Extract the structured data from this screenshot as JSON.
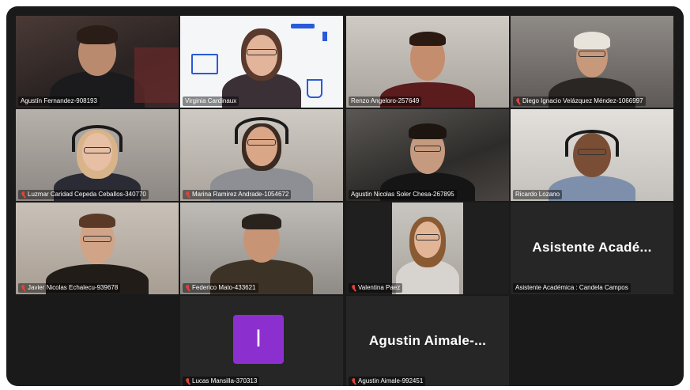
{
  "participants": [
    {
      "name": "Agustín Fernandez-908193",
      "muted": false
    },
    {
      "name": "Virginia Cardinaux",
      "muted": false,
      "speaking": true
    },
    {
      "name": "Renzo Angelo​ro-257649",
      "muted": false
    },
    {
      "name": "Diego Ignacio Velázquez Méndez-1066997",
      "muted": true
    },
    {
      "name": "Luzmar Caridad Cepeda Ceballos-340770",
      "muted": true
    },
    {
      "name": "Marina Ramirez Andrade-1054672",
      "muted": true
    },
    {
      "name": "Agustin Nicolas Soler Chesa-267895",
      "muted": false
    },
    {
      "name": "Ricardo Lozano",
      "muted": false
    },
    {
      "name": "Javier Nicolas Echalecu-939678",
      "muted": true
    },
    {
      "name": "Federico Mato-433621",
      "muted": true
    },
    {
      "name": "Valentina Paez",
      "muted": true
    },
    {
      "name": "Asistente Académica : Candela Campos",
      "muted": false,
      "display": "Asistente  Acadé..."
    },
    {
      "name": "Lucas Mansilla-370313",
      "muted": true,
      "avatar_letter": "l"
    },
    {
      "name": "Agustin Aimale-992451",
      "muted": true,
      "display": "Agustin  Aimale-..."
    }
  ],
  "colors": {
    "active_border": "#2fd06c",
    "muted_icon": "#e0433a",
    "avatar_bg": "#8c2fcf",
    "frame_bg": "#1a1a1a"
  }
}
